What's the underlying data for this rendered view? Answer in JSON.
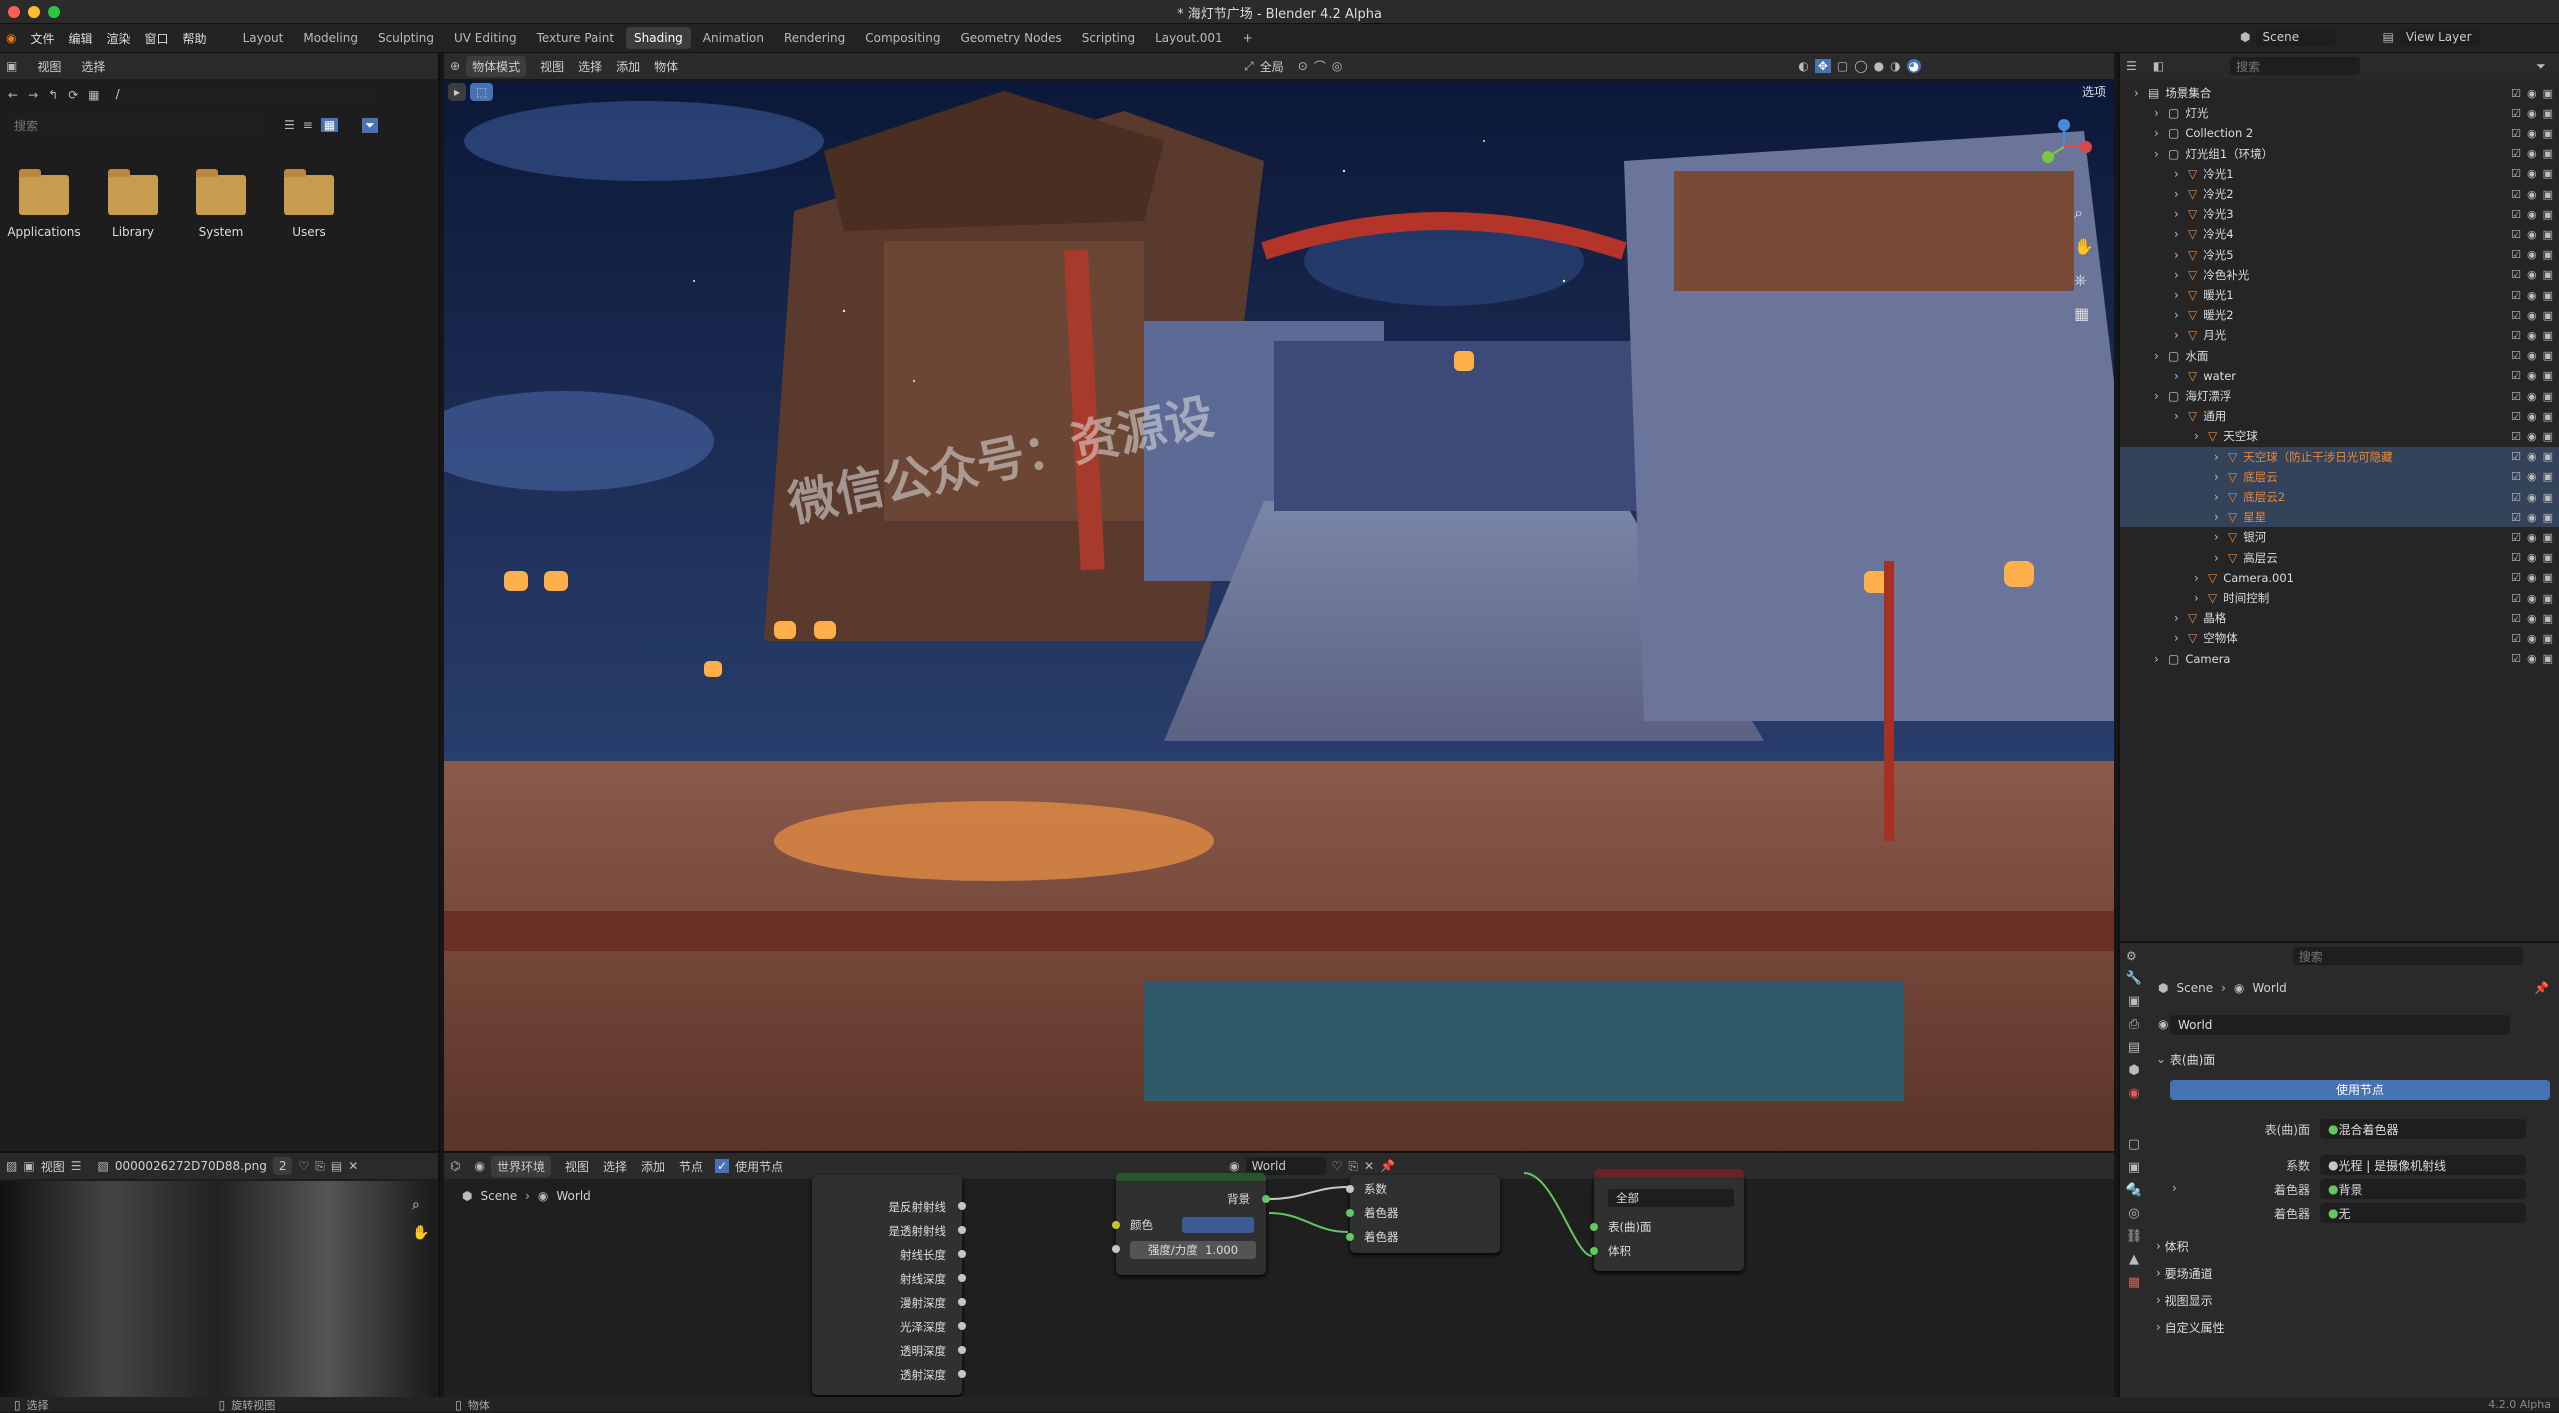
{
  "window_title": "* 海灯节广场 - Blender 4.2 Alpha",
  "top_menu": [
    "文件",
    "编辑",
    "渲染",
    "窗口",
    "帮助"
  ],
  "workspace_tabs": [
    "Layout",
    "Modeling",
    "Sculpting",
    "UV Editing",
    "Texture Paint",
    "Shading",
    "Animation",
    "Rendering",
    "Compositing",
    "Geometry Nodes",
    "Scripting",
    "Layout.001"
  ],
  "active_workspace": "Shading",
  "scene_name": "Scene",
  "view_layer": "View Layer",
  "file_browser": {
    "menu": [
      "视图",
      "选择"
    ],
    "path": "/",
    "search_placeholder": "搜索",
    "folders": [
      "Applications",
      "Library",
      "System",
      "Users"
    ]
  },
  "viewport": {
    "mode": "物体模式",
    "menu": [
      "视图",
      "选择",
      "添加",
      "物体"
    ],
    "transform": "全局",
    "options_label": "选项",
    "watermark": "微信公众号：资源设"
  },
  "outliner": {
    "search_placeholder": "搜索",
    "rows": [
      {
        "name": "场景集合",
        "indent": 0
      },
      {
        "name": "灯光",
        "indent": 1
      },
      {
        "name": "Collection 2",
        "indent": 1
      },
      {
        "name": "灯光组1（环境）",
        "indent": 1
      },
      {
        "name": "冷光1",
        "indent": 2
      },
      {
        "name": "冷光2",
        "indent": 2
      },
      {
        "name": "冷光3",
        "indent": 2
      },
      {
        "name": "冷光4",
        "indent": 2
      },
      {
        "name": "冷光5",
        "indent": 2
      },
      {
        "name": "冷色补光",
        "indent": 2
      },
      {
        "name": "暖光1",
        "indent": 2
      },
      {
        "name": "暖光2",
        "indent": 2
      },
      {
        "name": "月光",
        "indent": 2
      },
      {
        "name": "水面",
        "indent": 1
      },
      {
        "name": "water",
        "indent": 2
      },
      {
        "name": "海灯漂浮",
        "indent": 1
      },
      {
        "name": "通用",
        "indent": 2
      },
      {
        "name": "天空球",
        "indent": 3
      },
      {
        "name": "天空球（防止干涉日光可隐藏",
        "indent": 4,
        "selected": true
      },
      {
        "name": "底层云",
        "indent": 4,
        "selected": true
      },
      {
        "name": "底层云2",
        "indent": 4,
        "selected": true
      },
      {
        "name": "星星",
        "indent": 4,
        "selected": true
      },
      {
        "name": "银河",
        "indent": 4
      },
      {
        "name": "高层云",
        "indent": 4
      },
      {
        "name": "Camera.001",
        "indent": 3
      },
      {
        "name": "时间控制",
        "indent": 3
      },
      {
        "name": "晶格",
        "indent": 2
      },
      {
        "name": "空物体",
        "indent": 2
      },
      {
        "name": "Camera",
        "indent": 1
      }
    ]
  },
  "properties": {
    "search_placeholder": "搜索",
    "breadcrumb": [
      "Scene",
      "World"
    ],
    "world_name": "World",
    "surface_label": "表(曲)面",
    "use_nodes_button": "使用节点",
    "fields": [
      {
        "label": "表(曲)面",
        "value": "混合着色器"
      },
      {
        "label": "系数",
        "value": "光程 | 是摄像机射线"
      },
      {
        "label": "着色器",
        "value": "背景"
      },
      {
        "label": "着色器",
        "value": "无"
      }
    ],
    "sections": [
      "体积",
      "要场通道",
      "视图显示",
      "自定义属性"
    ]
  },
  "image_editor": {
    "menu": [
      "视图"
    ],
    "image_name": "0000026272D70D88.png",
    "users": "2"
  },
  "node_editor": {
    "type": "世界环境",
    "menu": [
      "视图",
      "选择",
      "添加",
      "节点"
    ],
    "use_nodes": "使用节点",
    "world": "World",
    "breadcrumb": [
      "Scene",
      "World"
    ],
    "light_path_outputs": [
      "是反射射线",
      "是透射射线",
      "射线长度",
      "射线深度",
      "漫射深度",
      "光泽深度",
      "透明深度",
      "透射深度"
    ],
    "background_node": {
      "output": "背景",
      "color_label": "颜色",
      "strength_label": "强度/力度",
      "strength_value": "1.000"
    },
    "mix_node": {
      "inputs": [
        "系数",
        "着色器",
        "着色器"
      ]
    },
    "output_node": {
      "target": "全部",
      "inputs": [
        "表(曲)面",
        "体积"
      ]
    }
  },
  "status_bar": {
    "left": "选择",
    "middle": "旋转视图",
    "right": "物体",
    "version": "4.2.0 Alpha"
  },
  "colors": {
    "accent": "#4772b3",
    "selection": "#34425a",
    "folder": "#c89c4e",
    "socket_green": "#63c763"
  }
}
